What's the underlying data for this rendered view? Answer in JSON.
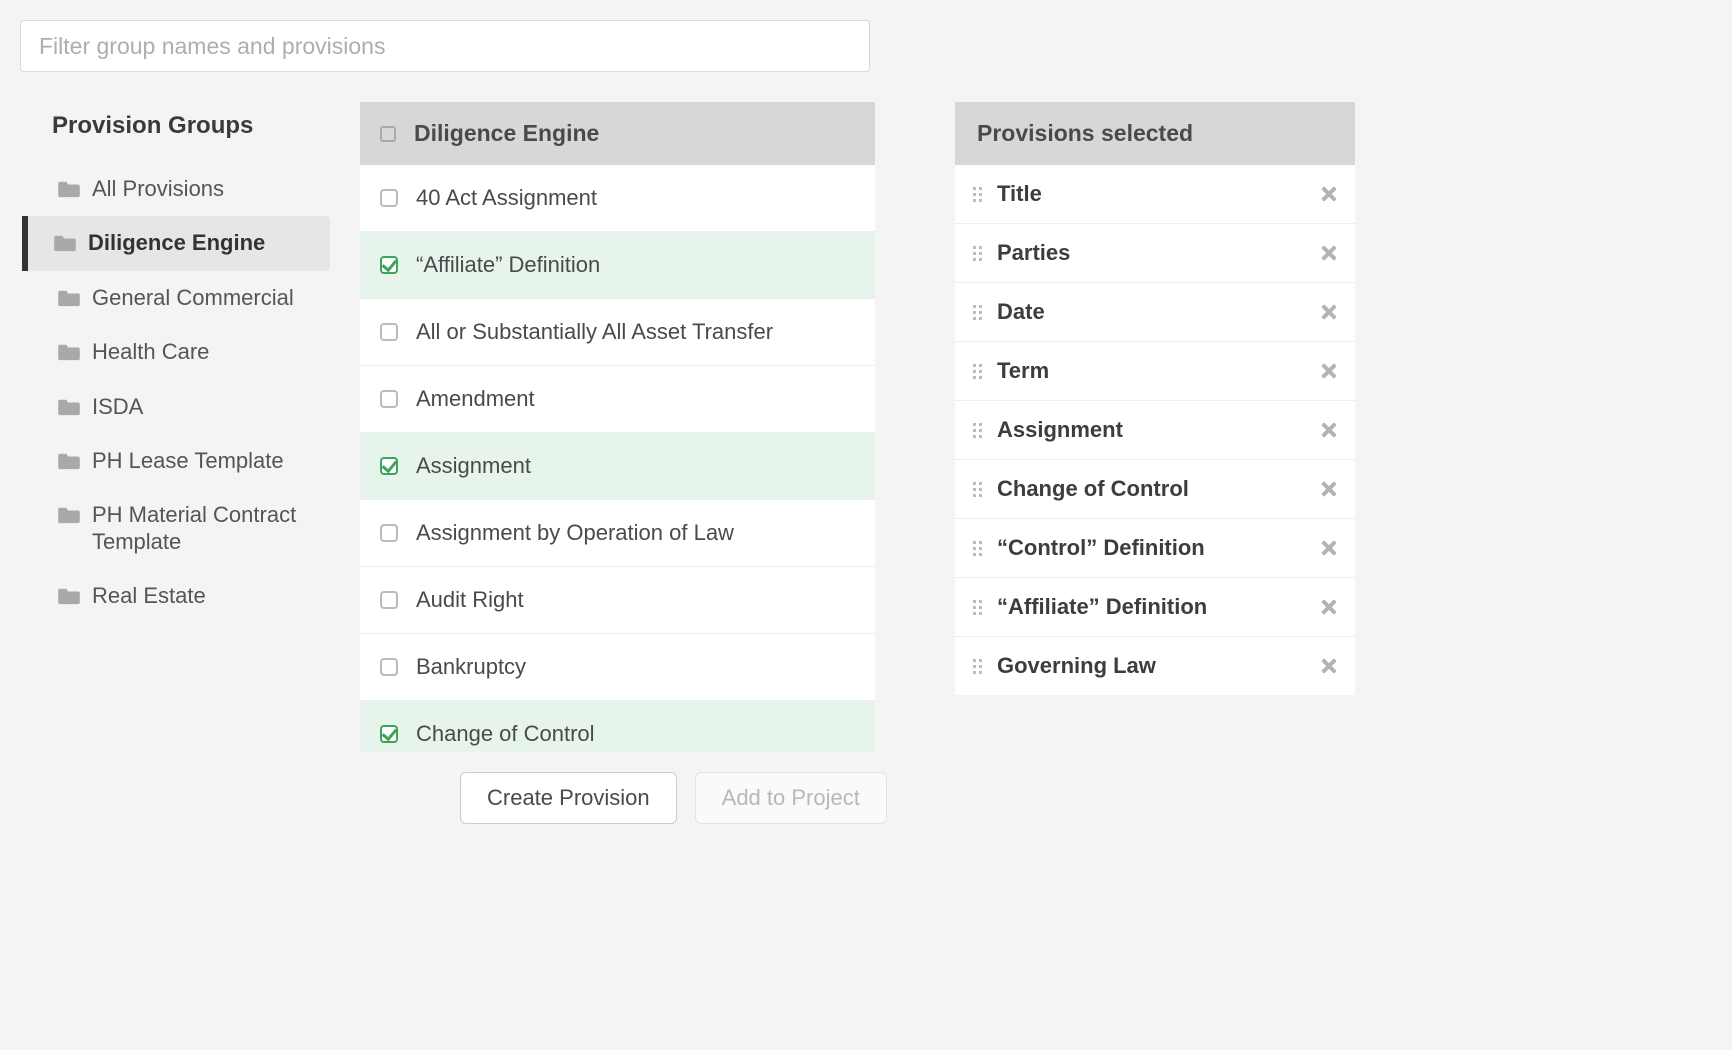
{
  "filter": {
    "placeholder": "Filter group names and provisions"
  },
  "sidebar": {
    "title": "Provision Groups",
    "groups": [
      {
        "label": "All Provisions",
        "active": false
      },
      {
        "label": "Diligence Engine",
        "active": true
      },
      {
        "label": "General Commercial",
        "active": false
      },
      {
        "label": "Health Care",
        "active": false
      },
      {
        "label": "ISDA",
        "active": false
      },
      {
        "label": "PH Lease Template",
        "active": false
      },
      {
        "label": "PH Material Contract Template",
        "active": false
      },
      {
        "label": "Real Estate",
        "active": false
      }
    ]
  },
  "provisions": {
    "header": "Diligence Engine",
    "items": [
      {
        "label": "40 Act Assignment",
        "checked": false
      },
      {
        "label": "“Affiliate” Definition",
        "checked": true
      },
      {
        "label": "All or Substantially All Asset Transfer",
        "checked": false
      },
      {
        "label": "Amendment",
        "checked": false
      },
      {
        "label": "Assignment",
        "checked": true
      },
      {
        "label": "Assignment by Operation of Law",
        "checked": false
      },
      {
        "label": "Audit Right",
        "checked": false
      },
      {
        "label": "Bankruptcy",
        "checked": false
      },
      {
        "label": "Change of Control",
        "checked": true
      }
    ]
  },
  "selected": {
    "header": "Provisions selected",
    "items": [
      {
        "label": "Title"
      },
      {
        "label": "Parties"
      },
      {
        "label": "Date"
      },
      {
        "label": "Term"
      },
      {
        "label": "Assignment"
      },
      {
        "label": "Change of Control"
      },
      {
        "label": "“Control” Definition"
      },
      {
        "label": "“Affiliate” Definition"
      },
      {
        "label": "Governing Law"
      }
    ]
  },
  "footer": {
    "create_label": "Create Provision",
    "add_label": "Add to Project"
  }
}
